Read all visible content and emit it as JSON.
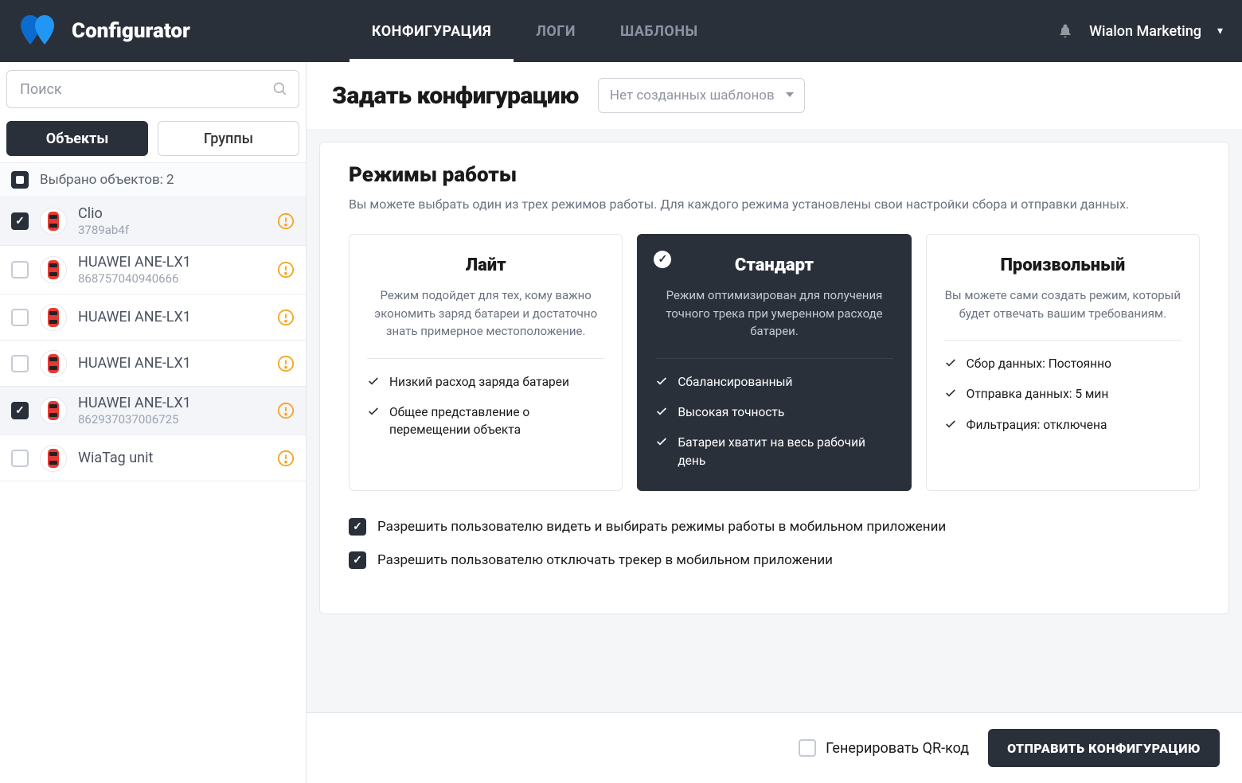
{
  "brand": "Configurator",
  "nav": {
    "items": [
      "КОНФИГУРАЦИЯ",
      "ЛОГИ",
      "ШАБЛОНЫ"
    ],
    "active": 0
  },
  "user": {
    "name": "Wialon Marketing"
  },
  "sidebar": {
    "search_placeholder": "Поиск",
    "tabs": {
      "objects": "Объекты",
      "groups": "Группы"
    },
    "selected_count_label": "Выбрано объектов: 2",
    "items": [
      {
        "name": "Clio",
        "id": "3789ab4f",
        "checked": true,
        "warn": true
      },
      {
        "name": "HUAWEI ANE-LX1",
        "id": "868757040940666",
        "checked": false,
        "warn": true
      },
      {
        "name": "HUAWEI ANE-LX1",
        "id": "",
        "checked": false,
        "warn": true
      },
      {
        "name": "HUAWEI ANE-LX1",
        "id": "",
        "checked": false,
        "warn": true
      },
      {
        "name": "HUAWEI ANE-LX1",
        "id": "862937037006725",
        "checked": true,
        "warn": true
      },
      {
        "name": "WiaTag unit",
        "id": "",
        "checked": false,
        "warn": true
      }
    ]
  },
  "page": {
    "title": "Задать конфигурацию",
    "template_placeholder": "Нет созданных шаблонов"
  },
  "modes_card": {
    "title": "Режимы работы",
    "subtitle": "Вы можете выбрать один из трех режимов работы. Для каждого режима установлены свои настройки сбора и отправки данных.",
    "modes": [
      {
        "title": "Лайт",
        "desc": "Режим подойдет для тех, кому важно экономить заряд батареи и достаточно знать примерное местоположение.",
        "features": [
          "Низкий расход заряда батареи",
          "Общее представление о перемещении объекта"
        ],
        "active": false
      },
      {
        "title": "Стандарт",
        "desc": "Режим оптимизирован для получения точного трека при умеренном расходе батареи.",
        "features": [
          "Сбалансированный",
          "Высокая точность",
          "Батареи хватит на весь рабочий день"
        ],
        "active": true
      },
      {
        "title": "Произвольный",
        "desc": "Вы можете сами создать режим, который будет отвечать вашим требованиям.",
        "features": [
          "Сбор данных: Постоянно",
          "Отправка данных: 5 мин",
          "Фильтрация: отключена"
        ],
        "active": false
      }
    ],
    "perms": [
      "Разрешить пользователю видеть и выбирать режимы работы в мобильном приложении",
      "Разрешить пользователю отключать трекер в мобильном приложении"
    ]
  },
  "footer": {
    "qr_label": "Генерировать QR-код",
    "send_label": "ОТПРАВИТЬ КОНФИГУРАЦИЮ"
  }
}
